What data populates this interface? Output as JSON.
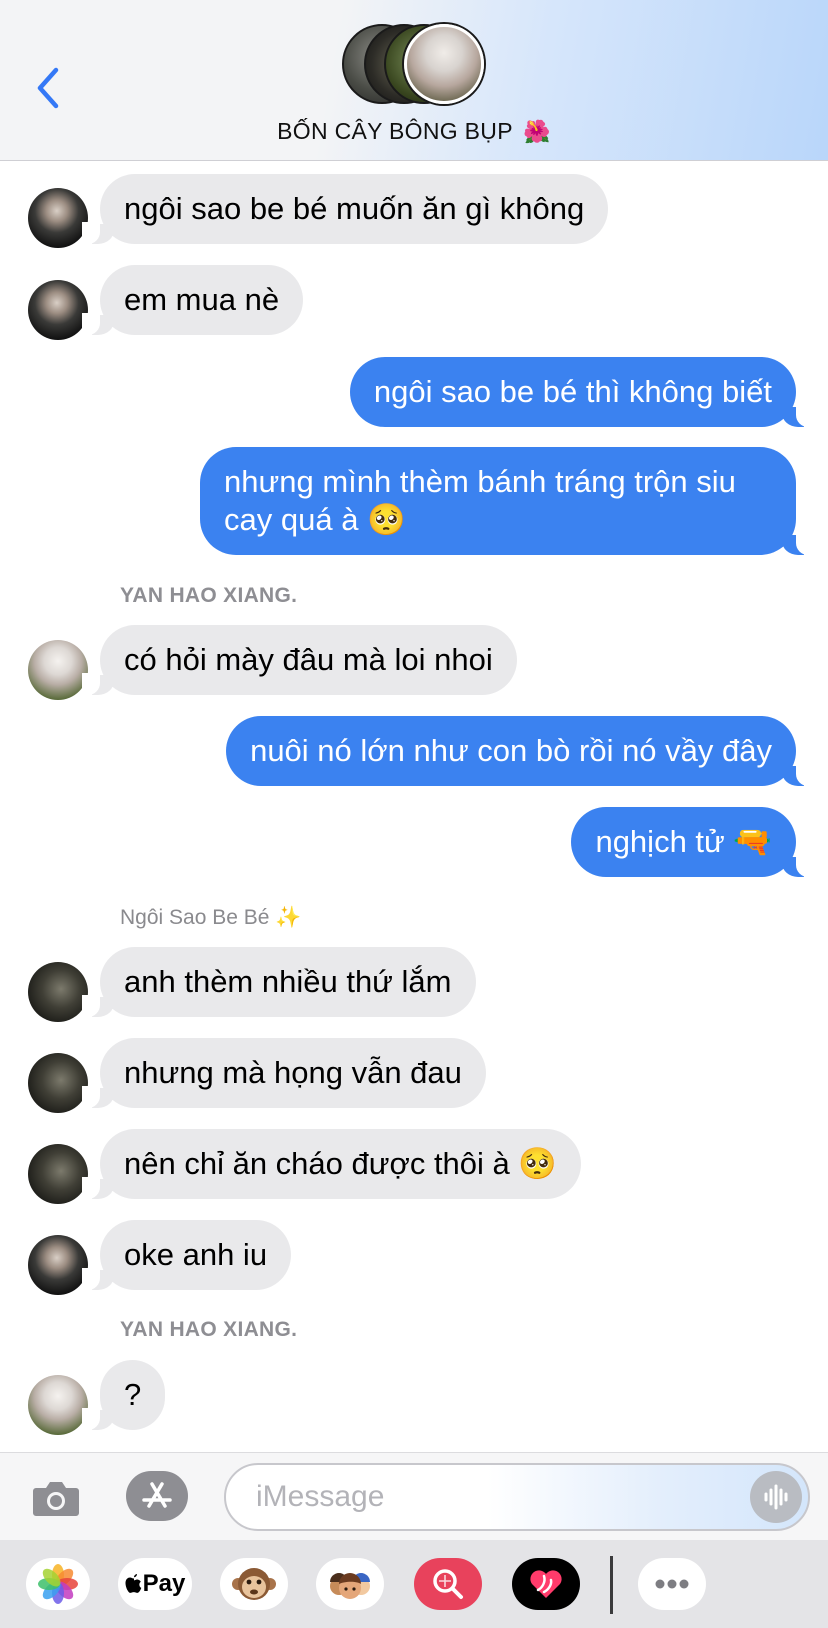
{
  "header": {
    "back_label": "Back",
    "group_name": "BỐN CÂY BÔNG BỤP",
    "group_emoji": "🌺",
    "member_count": 4
  },
  "messages": [
    {
      "side": "in",
      "avatar": "dark",
      "text": "ngôi sao be bé muốn ăn gì không"
    },
    {
      "side": "in",
      "avatar": "dark",
      "text": "em mua nè"
    },
    {
      "side": "out",
      "text": "ngôi sao be bé thì không biết"
    },
    {
      "side": "out",
      "text": "nhưng mình thèm bánh tráng trộn siu cay quá à 🥺"
    },
    {
      "side": "sender",
      "text": "YAN HAO XIANG."
    },
    {
      "side": "in",
      "avatar": "white",
      "text": "có hỏi mày đâu mà loi nhoi"
    },
    {
      "side": "out",
      "text": "nuôi nó lớn như con bò rồi nó vầy đây"
    },
    {
      "side": "out",
      "text": "nghịch tử 🔫"
    },
    {
      "side": "sender",
      "text": "Ngôi Sao Be Bé ✨"
    },
    {
      "side": "in",
      "avatar": "shadow",
      "text": "anh thèm nhiều thứ lắm"
    },
    {
      "side": "in",
      "avatar": "shadow",
      "text": "nhưng mà họng vẫn đau"
    },
    {
      "side": "in",
      "avatar": "shadow",
      "text": "nên chỉ ăn cháo được thôi à 🥺"
    },
    {
      "side": "in",
      "avatar": "dark",
      "text": "oke anh iu"
    },
    {
      "side": "sender",
      "text": "YAN HAO XIANG."
    },
    {
      "side": "in",
      "avatar": "white",
      "text": "?"
    }
  ],
  "input": {
    "placeholder": "iMessage"
  },
  "drawer": {
    "apps": [
      "photos-icon",
      "apple-pay-icon",
      "animoji-icon",
      "memoji-icon",
      "image-search-icon",
      "digital-touch-icon",
      "more-icon"
    ],
    "apple_pay_label": "Pay"
  },
  "colors": {
    "outgoing": "#3b82f0",
    "incoming": "#e9e9eb",
    "accent": "#3478f6"
  }
}
